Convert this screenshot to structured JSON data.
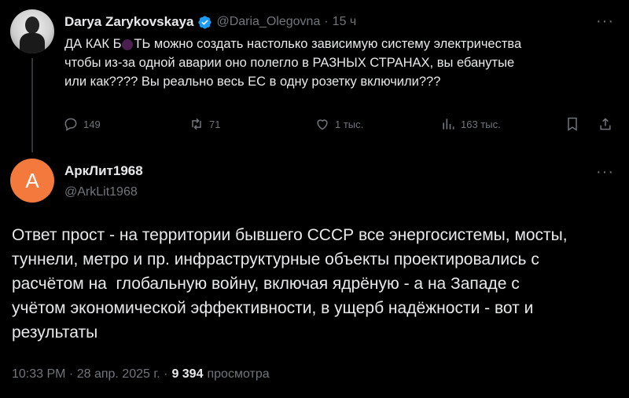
{
  "parent_tweet": {
    "author_name": "Darya Zarykovskaya",
    "author_handle": "@Daria_Olegovna",
    "separator": "·",
    "time_ago": "15 ч",
    "text_line1_part1": "ДА КАК Б",
    "text_line1_part2": "ТЬ можно создать настолько зависимую систему электричества",
    "text_line2": "чтобы из-за одной аварии оно полегло в РАЗНЫХ СТРАНАХ, вы ебанутые",
    "text_line3": "или как???? Вы реально весь ЕС в одну розетку включили???",
    "replies": "149",
    "reposts": "71",
    "likes": "1 тыс.",
    "views": "163 тыс.",
    "more": "···"
  },
  "reply_tweet": {
    "avatar_letter": "А",
    "author_name": "АркЛит1968",
    "author_handle": "@ArkLit1968",
    "more": "···",
    "lines": [
      "Ответ прост - на территории бывшего СССР все энергосистемы, мосты,",
      "туннели, метро и пр. инфраструктурные объекты проектировались с",
      "расчётом на  глобальную войну, включая ядрёную - а на Западе с",
      "учётом экономической эффективности, в ущерб надёжности - вот и",
      "результаты"
    ],
    "timestamp": "10:33 PM · 28 апр. 2025 г. ·",
    "views_count": "9 394",
    "views_label": "просмотра"
  },
  "colors": {
    "background": "#000000",
    "text": "#e7e9ea",
    "muted": "#71767b",
    "verified": "#1d9bf0",
    "avatar_orange": "#f4793d"
  }
}
